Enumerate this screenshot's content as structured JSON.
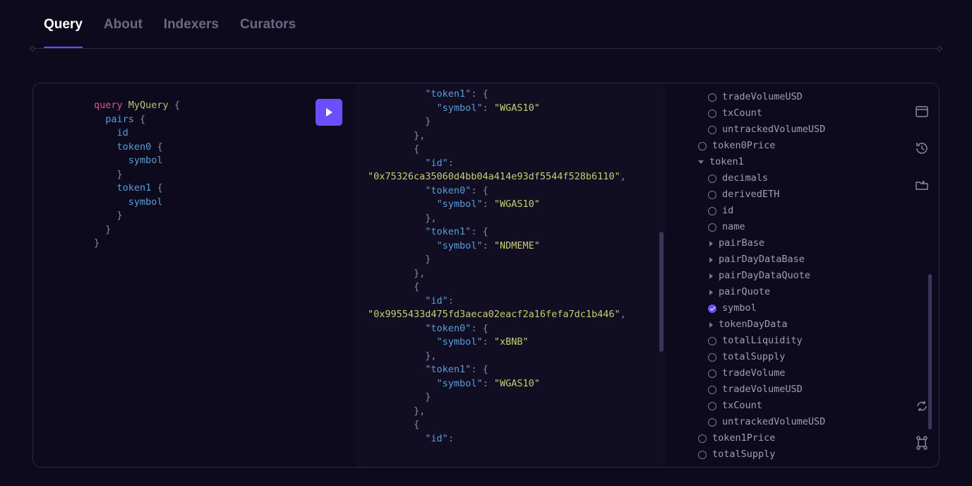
{
  "tabs": {
    "query": "Query",
    "about": "About",
    "indexers": "Indexers",
    "curators": "Curators"
  },
  "editor": {
    "keyword": "query",
    "name": "MyQuery",
    "brace_open": "{",
    "brace_close": "}",
    "pairs": "pairs",
    "id": "id",
    "token0": "token0",
    "token1": "token1",
    "symbol": "symbol"
  },
  "result": {
    "items": [
      {
        "leading": true,
        "token1_sym": "WGAS10"
      },
      {
        "id": "0x75326ca35060d4bb04a414e93df5544f528b6110",
        "token0_sym": "WGAS10",
        "token1_sym": "NDMEME"
      },
      {
        "id": "0x9955433d475fd3aeca02eacf2a16fefa7dc1b446",
        "token0_sym": "xBNB",
        "token1_sym": "WGAS10"
      },
      {
        "id_only": true
      }
    ],
    "keys": {
      "id": "id",
      "token0": "token0",
      "token1": "token1",
      "symbol": "symbol"
    }
  },
  "explorer": {
    "l1": [
      {
        "type": "circle",
        "label": "tradeVolumeUSD"
      },
      {
        "type": "circle",
        "label": "txCount"
      },
      {
        "type": "circle",
        "label": "untrackedVolumeUSD"
      }
    ],
    "token0Price": "token0Price",
    "token1": "token1",
    "token1_children": [
      {
        "type": "circle",
        "label": "decimals"
      },
      {
        "type": "circle",
        "label": "derivedETH"
      },
      {
        "type": "circle",
        "label": "id"
      },
      {
        "type": "circle",
        "label": "name"
      },
      {
        "type": "tri",
        "label": "pairBase"
      },
      {
        "type": "tri",
        "label": "pairDayDataBase"
      },
      {
        "type": "tri",
        "label": "pairDayDataQuote"
      },
      {
        "type": "tri",
        "label": "pairQuote"
      },
      {
        "type": "checked",
        "label": "symbol"
      },
      {
        "type": "tri",
        "label": "tokenDayData"
      },
      {
        "type": "circle",
        "label": "totalLiquidity"
      },
      {
        "type": "circle",
        "label": "totalSupply"
      },
      {
        "type": "circle",
        "label": "tradeVolume"
      },
      {
        "type": "circle",
        "label": "tradeVolumeUSD"
      },
      {
        "type": "circle",
        "label": "txCount"
      },
      {
        "type": "circle",
        "label": "untrackedVolumeUSD"
      }
    ],
    "token1Price": "token1Price",
    "totalSupply": "totalSupply"
  }
}
